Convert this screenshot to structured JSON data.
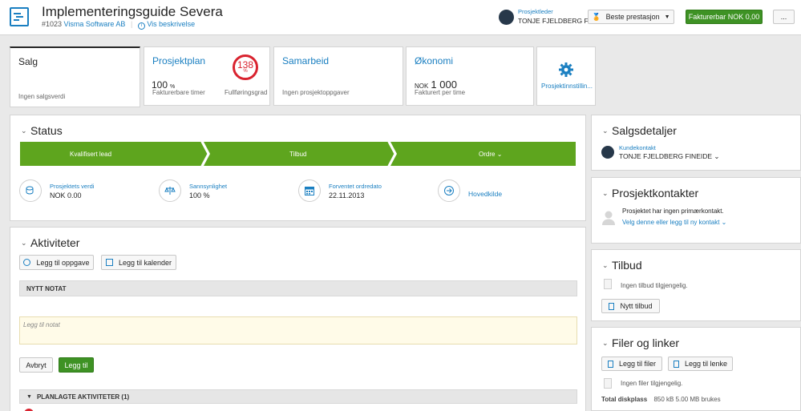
{
  "header": {
    "title": "Implementeringsguide Severa",
    "project_number": "#1023",
    "company": "Visma Software AB",
    "description_link": "Vis beskrivelse",
    "manager_label": "Prosjektleder",
    "manager_name": "TONJE FJELDBERG F...",
    "best_label": "Beste prestasjon",
    "billable_label": "Fakturerbar NOK 0,00",
    "more_label": "..."
  },
  "tabs": {
    "salg": {
      "title": "Salg",
      "foot": "Ingen salgsverdi"
    },
    "plan": {
      "title": "Prosjektplan",
      "value": "100",
      "unit": "%",
      "foot": "Fakturerbare timer",
      "gauge_value": "138",
      "gauge_unit": "%",
      "gauge_label": "Fullføringsgrad"
    },
    "samarbeid": {
      "title": "Samarbeid",
      "foot": "Ingen prosjektoppgaver"
    },
    "okonomi": {
      "title": "Økonomi",
      "currency": "NOK",
      "value": "1 000",
      "foot": "Fakturert per time"
    },
    "settings": {
      "label": "Prosjektinnstillin..."
    }
  },
  "status": {
    "title": "Status",
    "steps": [
      "Kvalifisert lead",
      "Tilbud",
      "Ordre"
    ],
    "stats": [
      {
        "label": "Prosjektets verdi",
        "value": "NOK 0.00"
      },
      {
        "label": "Sannsynlighet",
        "value": "100 %"
      },
      {
        "label": "Forventet ordredato",
        "value": "22.11.2013"
      },
      {
        "label": "",
        "value": "Hovedkilde"
      }
    ]
  },
  "activities": {
    "title": "Aktiviteter",
    "add_task": "Legg til oppgave",
    "add_calendar": "Legg til kalender",
    "new_note": "NYTT NOTAT",
    "note_placeholder": "Legg til notat",
    "cancel": "Avbryt",
    "add": "Legg til",
    "planned": "PLANLAGTE AKTIVITETER (1)"
  },
  "side": {
    "sales": {
      "title": "Salgsdetaljer",
      "contact_label": "Kundekontakt",
      "contact_name": "TONJE FJELDBERG FINEIDE"
    },
    "contacts": {
      "title": "Prosjektkontakter",
      "none": "Prosjektet har ingen primærkontakt.",
      "link": "Velg denne eller legg til ny kontakt"
    },
    "offers": {
      "title": "Tilbud",
      "none": "Ingen tilbud tilgjengelig.",
      "new": "Nytt tilbud"
    },
    "files": {
      "title": "Filer og linker",
      "add_files": "Legg til filer",
      "add_link": "Legg til lenke",
      "none": "Ingen filer tilgjengelig.",
      "disk_label": "Total diskplass",
      "disk_value": "850 kB 5.00 MB brukes"
    }
  },
  "colors": {
    "accent": "#1a7fc1",
    "green": "#5ea51e",
    "red": "#d9232f"
  }
}
